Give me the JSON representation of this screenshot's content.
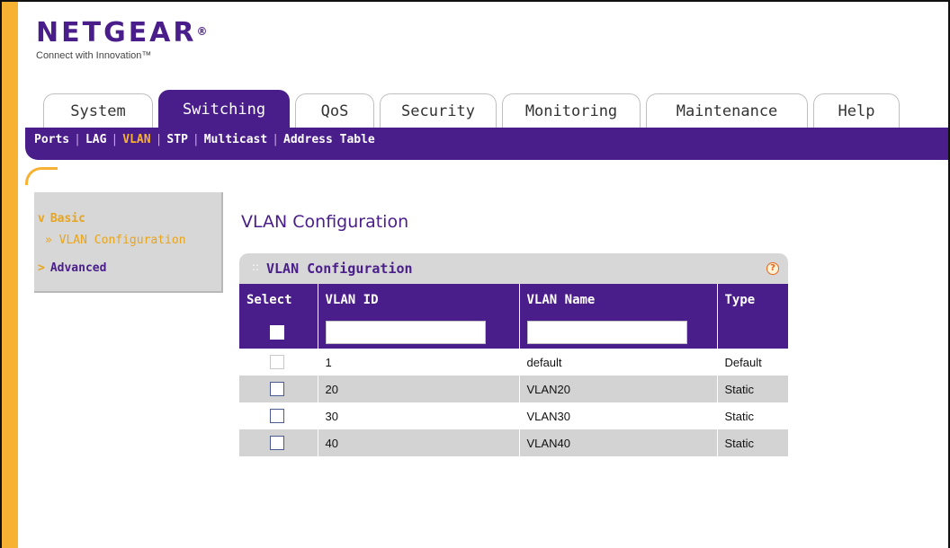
{
  "brand": {
    "logo": "NETGEAR",
    "logo_mark": "®",
    "tagline": "Connect with Innovation™"
  },
  "tabs": [
    {
      "label": "System",
      "active": false
    },
    {
      "label": "Switching",
      "active": true
    },
    {
      "label": "QoS",
      "active": false
    },
    {
      "label": "Security",
      "active": false
    },
    {
      "label": "Monitoring",
      "active": false
    },
    {
      "label": "Maintenance",
      "active": false
    },
    {
      "label": "Help",
      "active": false
    }
  ],
  "subnav": [
    {
      "label": "Ports",
      "active": false
    },
    {
      "label": "LAG",
      "active": false
    },
    {
      "label": "VLAN",
      "active": true
    },
    {
      "label": "STP",
      "active": false
    },
    {
      "label": "Multicast",
      "active": false
    },
    {
      "label": "Address Table",
      "active": false
    }
  ],
  "sidebar": {
    "basic": "Basic",
    "config_link": "» VLAN Configuration",
    "advanced": "Advanced"
  },
  "page_title": "VLAN Configuration",
  "panel": {
    "title": "VLAN Configuration",
    "help": "?"
  },
  "table": {
    "columns": [
      "Select",
      "VLAN ID",
      "VLAN Name",
      "Type"
    ],
    "rows": [
      {
        "id": "1",
        "name": "default",
        "type": "Default",
        "selectable": false
      },
      {
        "id": "20",
        "name": "VLAN20",
        "type": "Static",
        "selectable": true
      },
      {
        "id": "30",
        "name": "VLAN30",
        "type": "Static",
        "selectable": true
      },
      {
        "id": "40",
        "name": "VLAN40",
        "type": "Static",
        "selectable": true
      }
    ]
  },
  "colors": {
    "purple": "#4a1e8a",
    "orange": "#f7b234",
    "row_alt": "#d3d3d3"
  }
}
